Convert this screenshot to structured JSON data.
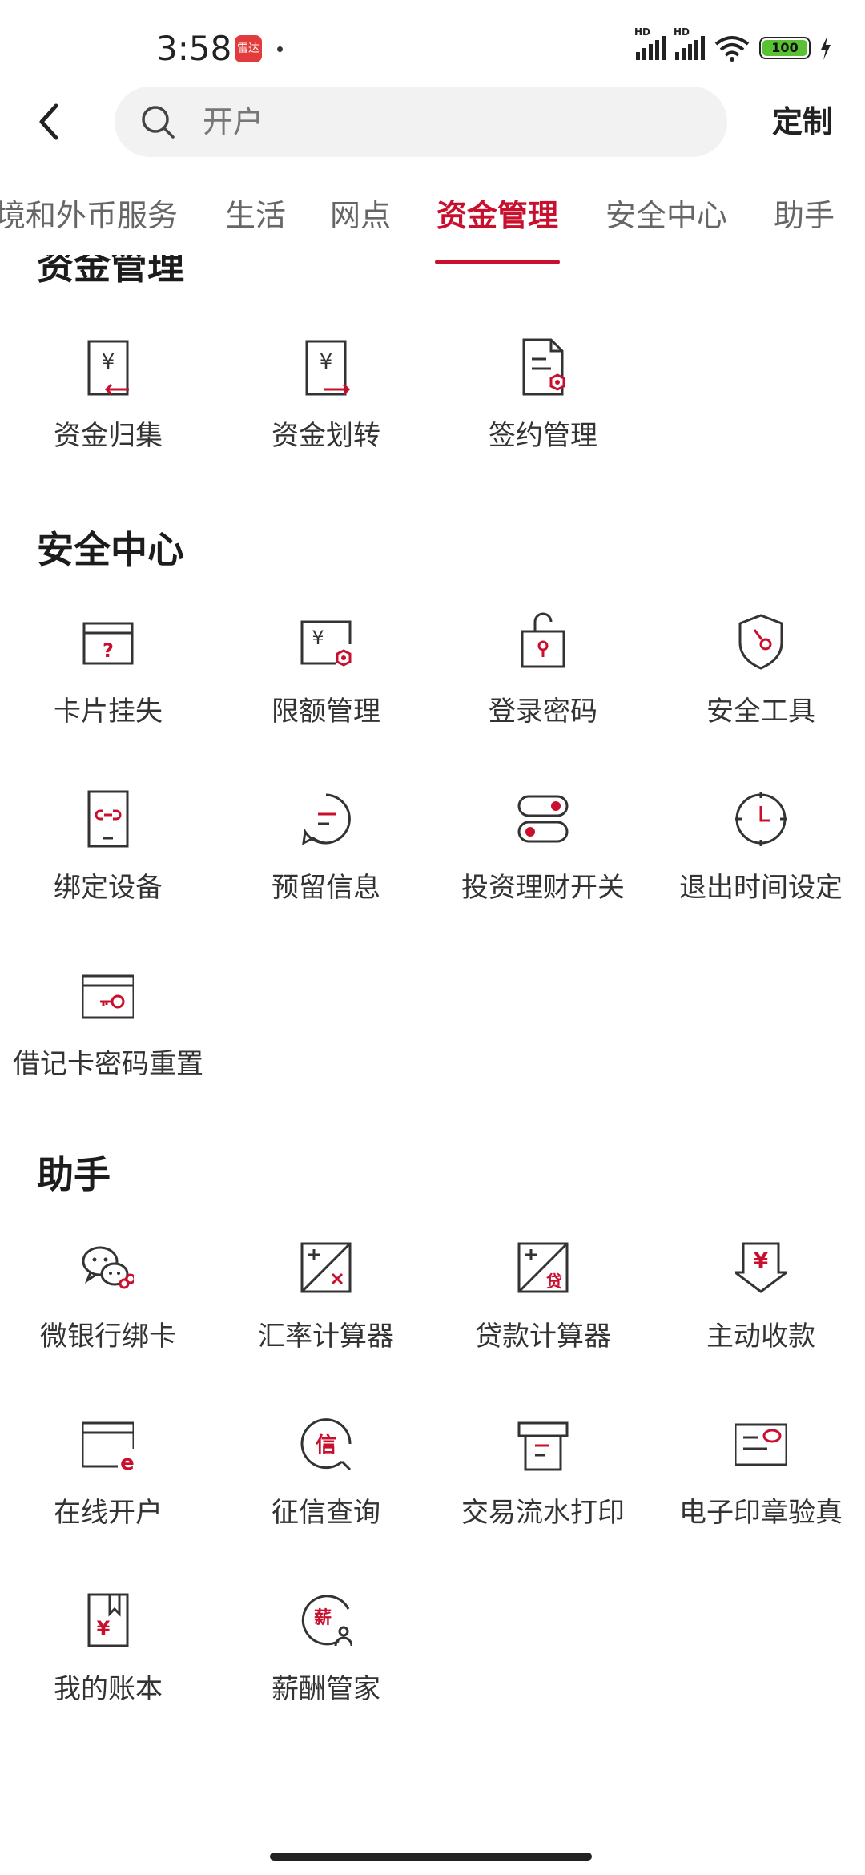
{
  "status_bar": {
    "time": "3:58",
    "app_badge": "雷达",
    "signal_label_1": "HD",
    "signal_label_2": "HD",
    "battery": "100"
  },
  "header": {
    "search_placeholder": "开户",
    "custom_label": "定制"
  },
  "tabs": [
    {
      "label": "境和外币服务",
      "active": false
    },
    {
      "label": "生活",
      "active": false
    },
    {
      "label": "网点",
      "active": false
    },
    {
      "label": "资金管理",
      "active": true
    },
    {
      "label": "安全中心",
      "active": false
    },
    {
      "label": "助手",
      "active": false
    }
  ],
  "sections": {
    "fund": {
      "title": "资金管理",
      "items": [
        {
          "label": "资金归集",
          "icon": "fund-collect-icon"
        },
        {
          "label": "资金划转",
          "icon": "fund-transfer-icon"
        },
        {
          "label": "签约管理",
          "icon": "contract-manage-icon"
        }
      ]
    },
    "security": {
      "title": "安全中心",
      "items": [
        {
          "label": "卡片挂失",
          "icon": "card-loss-icon"
        },
        {
          "label": "限额管理",
          "icon": "limit-manage-icon"
        },
        {
          "label": "登录密码",
          "icon": "login-password-icon"
        },
        {
          "label": "安全工具",
          "icon": "security-tool-icon"
        },
        {
          "label": "绑定设备",
          "icon": "bind-device-icon"
        },
        {
          "label": "预留信息",
          "icon": "reserved-info-icon"
        },
        {
          "label": "投资理财开关",
          "icon": "invest-switch-icon"
        },
        {
          "label": "退出时间设定",
          "icon": "logout-timer-icon"
        },
        {
          "label": "借记卡密码重置",
          "icon": "debit-card-reset-icon"
        }
      ]
    },
    "assistant": {
      "title": "助手",
      "items": [
        {
          "label": "微银行绑卡",
          "icon": "wechat-bank-icon"
        },
        {
          "label": "汇率计算器",
          "icon": "fx-calculator-icon"
        },
        {
          "label": "贷款计算器",
          "icon": "loan-calculator-icon"
        },
        {
          "label": "主动收款",
          "icon": "receive-payment-icon"
        },
        {
          "label": "在线开户",
          "icon": "online-account-icon"
        },
        {
          "label": "征信查询",
          "icon": "credit-query-icon"
        },
        {
          "label": "交易流水打印",
          "icon": "statement-print-icon"
        },
        {
          "label": "电子印章验真",
          "icon": "e-seal-verify-icon"
        },
        {
          "label": "我的账本",
          "icon": "my-ledger-icon"
        },
        {
          "label": "薪酬管家",
          "icon": "salary-manager-icon"
        }
      ]
    }
  },
  "icon_text": {
    "yuan": "¥",
    "question": "?",
    "xin": "信",
    "dai": "贷",
    "xin2": "薪",
    "e": "e"
  },
  "colors": {
    "accent": "#c8102e",
    "icon_stroke": "#333333"
  }
}
